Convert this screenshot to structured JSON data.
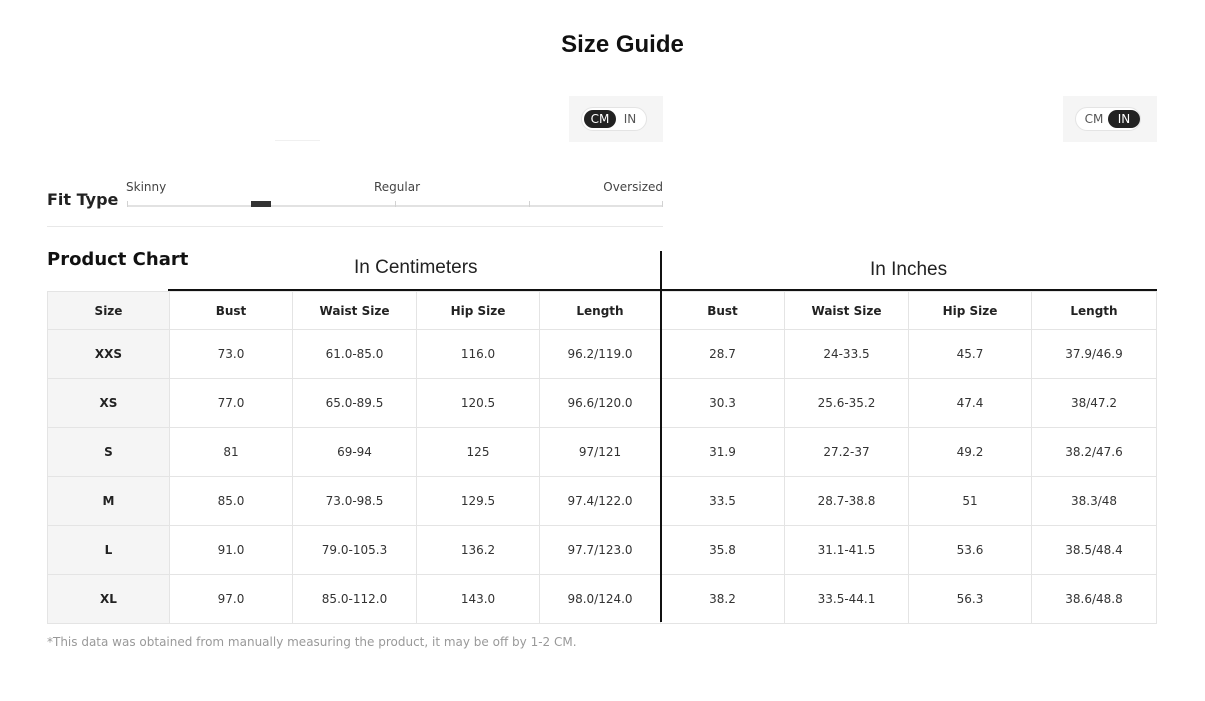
{
  "title": "Size Guide",
  "unit_toggle": {
    "cm_label": "CM",
    "in_label": "IN",
    "left_active": "CM",
    "right_active": "IN"
  },
  "fit_type": {
    "label": "Fit Type",
    "options": [
      "Skinny",
      "Regular",
      "Oversized"
    ],
    "level": 0.25
  },
  "product_chart": {
    "title": "Product Chart",
    "cm_header": "In Centimeters",
    "in_header": "In Inches",
    "columns": [
      "Size",
      "Bust",
      "Waist Size",
      "Hip Size",
      "Length",
      "Bust",
      "Waist Size",
      "Hip Size",
      "Length"
    ],
    "rows": [
      [
        "XXS",
        "73.0",
        "61.0-85.0",
        "116.0",
        "96.2/119.0",
        "28.7",
        "24-33.5",
        "45.7",
        "37.9/46.9"
      ],
      [
        "XS",
        "77.0",
        "65.0-89.5",
        "120.5",
        "96.6/120.0",
        "30.3",
        "25.6-35.2",
        "47.4",
        "38/47.2"
      ],
      [
        "S",
        "81",
        "69-94",
        "125",
        "97/121",
        "31.9",
        "27.2-37",
        "49.2",
        "38.2/47.6"
      ],
      [
        "M",
        "85.0",
        "73.0-98.5",
        "129.5",
        "97.4/122.0",
        "33.5",
        "28.7-38.8",
        "51",
        "38.3/48"
      ],
      [
        "L",
        "91.0",
        "79.0-105.3",
        "136.2",
        "97.7/123.0",
        "35.8",
        "31.1-41.5",
        "53.6",
        "38.5/48.4"
      ],
      [
        "XL",
        "97.0",
        "85.0-112.0",
        "143.0",
        "98.0/124.0",
        "38.2",
        "33.5-44.1",
        "56.3",
        "38.6/48.8"
      ]
    ]
  },
  "note": "*This data was obtained from manually measuring the product, it may be off by 1-2 CM."
}
